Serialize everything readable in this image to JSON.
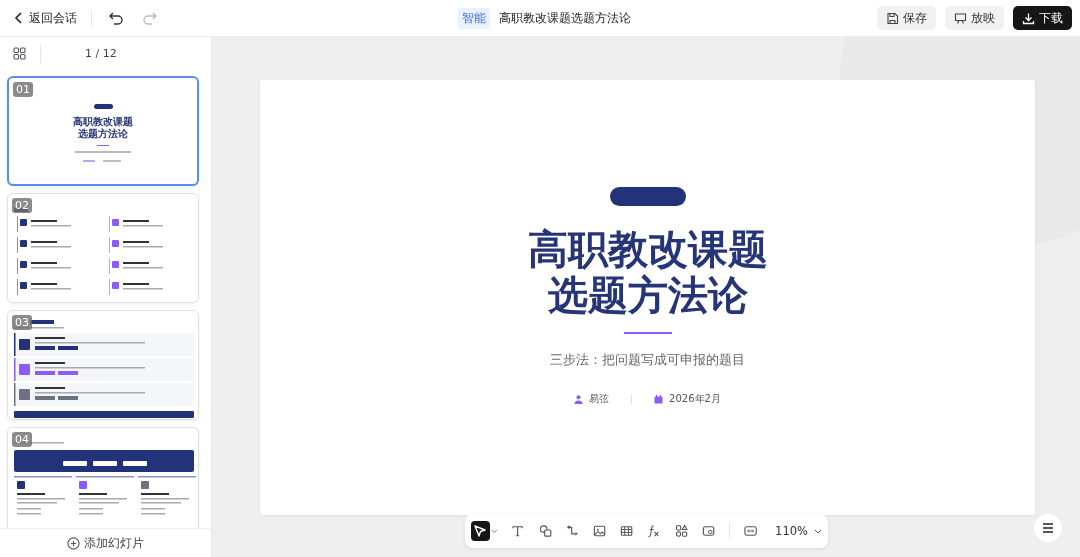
{
  "topbar": {
    "back": "返回会话",
    "badge": "智能",
    "title": "高职教改课题选题方法论",
    "buttons": [
      {
        "label": "保存",
        "kind": "save"
      },
      {
        "label": "放映",
        "kind": "present"
      },
      {
        "label": "下载",
        "kind": "download"
      }
    ]
  },
  "sidebar": {
    "page_counter": "1 / 12",
    "slides": [
      {
        "number": "01",
        "selected": true,
        "kind": "cover",
        "title_lines": [
          "高职教改课题",
          "选题方法论"
        ]
      },
      {
        "number": "02",
        "selected": false,
        "kind": "grid"
      },
      {
        "number": "03",
        "selected": false,
        "kind": "list"
      },
      {
        "number": "04",
        "selected": false,
        "kind": "columns"
      }
    ],
    "add_button": "添加幻灯片"
  },
  "slide": {
    "title_lines": [
      "高职教改课题",
      "选题方法论"
    ],
    "subtitle": "三步法：把问题写成可申报的题目",
    "author": "易弦",
    "date": "2026年2月"
  },
  "toolbar": {
    "zoom": "110%"
  }
}
